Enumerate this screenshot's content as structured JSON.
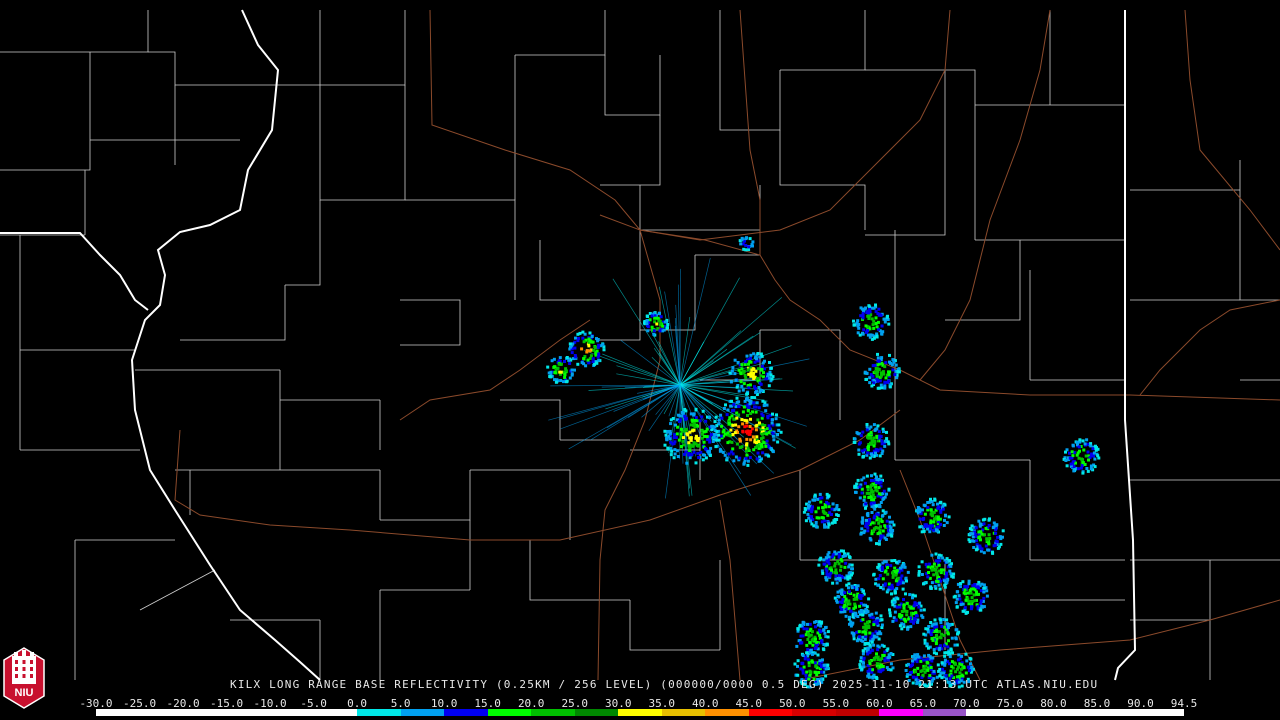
{
  "title_line": "KILX LONG RANGE BASE REFLECTIVITY (0.25KM / 256 LEVEL) (000000/0000 0.5 DEG) 2025-11-10 21:13 UTC  ATLAS.NIU.EDU",
  "logo_text": "NIU",
  "scale": {
    "labels": [
      "-30.0",
      "-25.0",
      "-20.0",
      "-15.0",
      "-10.0",
      "-5.0",
      "0.0",
      "5.0",
      "10.0",
      "15.0",
      "20.0",
      "25.0",
      "30.0",
      "35.0",
      "40.0",
      "45.0",
      "50.0",
      "55.0",
      "60.0",
      "65.0",
      "70.0",
      "75.0",
      "80.0",
      "85.0",
      "90.0",
      "94.5"
    ],
    "colors": [
      "#000000",
      "#000000",
      "#000000",
      "#000000",
      "#000000",
      "#000000",
      "#00e8e8",
      "#00a0f0",
      "#0000f0",
      "#00ff00",
      "#00c000",
      "#008800",
      "#ffff00",
      "#e7c000",
      "#ff9000",
      "#ff0000",
      "#d60000",
      "#c00000",
      "#ff00ff",
      "#9955c9",
      "#ffffff",
      "#ffffff",
      "#ffffff",
      "#ffffff",
      "#ffffff"
    ]
  },
  "colors": {
    "background": "#000000",
    "county_lines": "#d8d8d8",
    "state_lines": "#ffffff",
    "roads": "#8b4a2b",
    "text": "#e8e8e8"
  }
}
